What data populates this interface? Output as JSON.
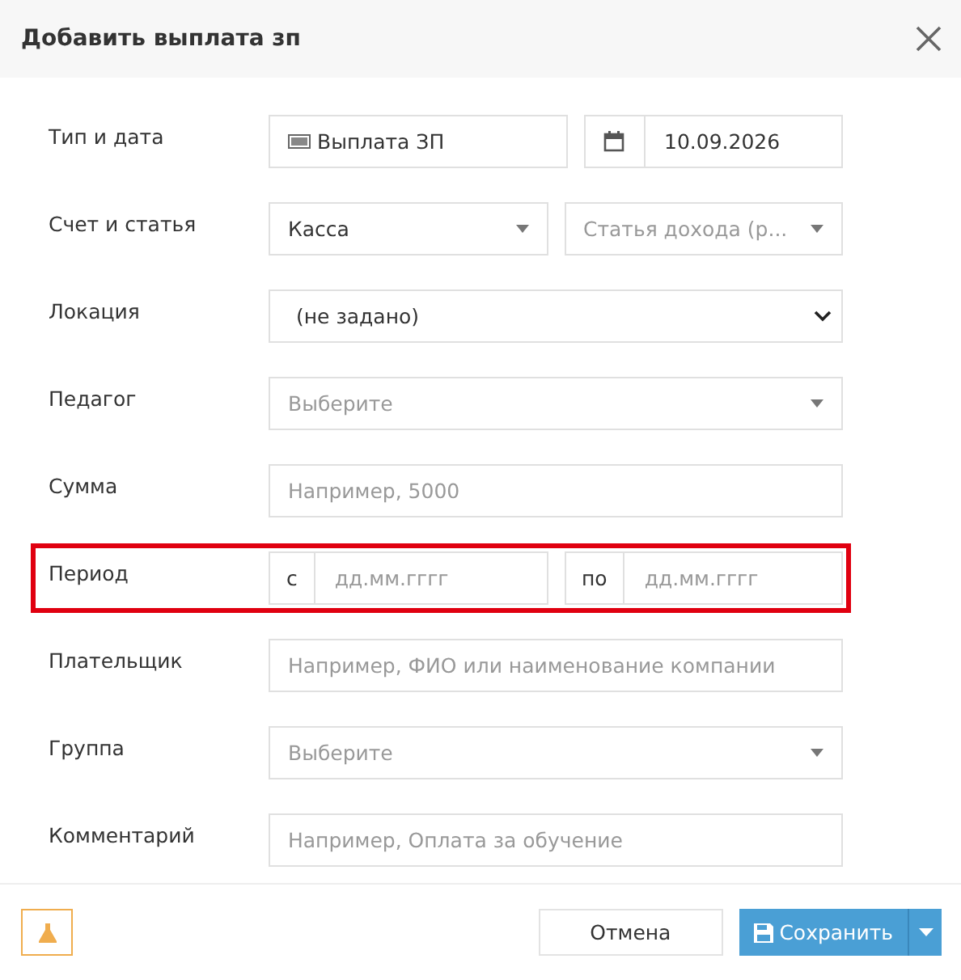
{
  "title": "Добавить выплата зп",
  "rows": [
    {
      "label": "Тип и дата",
      "highlighted": false,
      "controls": [
        {
          "kind": "type",
          "value": "Выплата ЗП"
        },
        {
          "kind": "date",
          "value": "10.09.2026"
        }
      ]
    },
    {
      "label": "Счет и статья",
      "highlighted": false,
      "controls": [
        {
          "kind": "select",
          "value": "Касса"
        },
        {
          "kind": "select",
          "placeholder": "Статья дохода (р..."
        }
      ]
    },
    {
      "label": "Локация",
      "highlighted": false,
      "controls": [
        {
          "kind": "native-select",
          "value": "(не задано)"
        }
      ]
    },
    {
      "label": "Педагог",
      "highlighted": false,
      "controls": [
        {
          "kind": "select",
          "placeholder": "Выберите"
        }
      ]
    },
    {
      "label": "Сумма",
      "highlighted": false,
      "controls": [
        {
          "kind": "input",
          "placeholder": "Например, 5000"
        }
      ]
    },
    {
      "label": "Период",
      "highlighted": true,
      "controls": [
        {
          "kind": "input",
          "addon": "с",
          "placeholder": "дд.мм.гггг"
        },
        {
          "kind": "input",
          "addon": "по",
          "placeholder": "дд.мм.гггг"
        }
      ]
    },
    {
      "label": "Плательщик",
      "highlighted": false,
      "controls": [
        {
          "kind": "input",
          "placeholder": "Например, ФИО или наименование компании"
        }
      ]
    },
    {
      "label": "Группа",
      "highlighted": false,
      "controls": [
        {
          "kind": "select",
          "placeholder": "Выберите"
        }
      ]
    },
    {
      "label": "Комментарий",
      "highlighted": false,
      "controls": [
        {
          "kind": "input",
          "placeholder": "Например, Оплата за обучение"
        }
      ]
    }
  ],
  "buttons": {
    "cancel": "Отмена",
    "save": "Сохранить"
  }
}
